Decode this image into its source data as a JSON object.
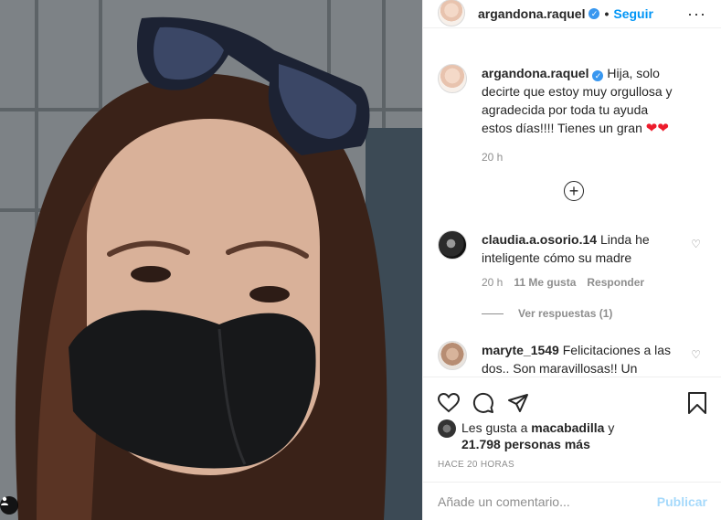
{
  "post": {
    "author": "argandona.raquel",
    "follow_label": "Seguir",
    "caption": "Hija, solo decirte que estoy muy orgullosa y agradecida por toda tu ayuda estos días!!!! Tienes un gran",
    "caption_time": "20 h"
  },
  "comments": [
    {
      "user": "claudia.a.osorio.14",
      "text": "Linda he inteligente cómo su madre",
      "time": "20 h",
      "likes": "11 Me gusta",
      "reply_label": "Responder",
      "view_replies": "Ver respuestas (1)"
    },
    {
      "user": "maryte_1549",
      "text": "Felicitaciones a las dos.. Son maravillosas!! Un abrazo"
    }
  ],
  "likes": {
    "prefix": "Les gusta a",
    "user": "macabadilla",
    "connector": "y",
    "others": "21.798 personas más"
  },
  "posted": "HACE 20 HORAS",
  "comment_box": {
    "placeholder": "Añade un comentario...",
    "publish_label": "Publicar"
  },
  "colors": {
    "accent": "#0095f6",
    "heart": "#ed1c2c"
  }
}
